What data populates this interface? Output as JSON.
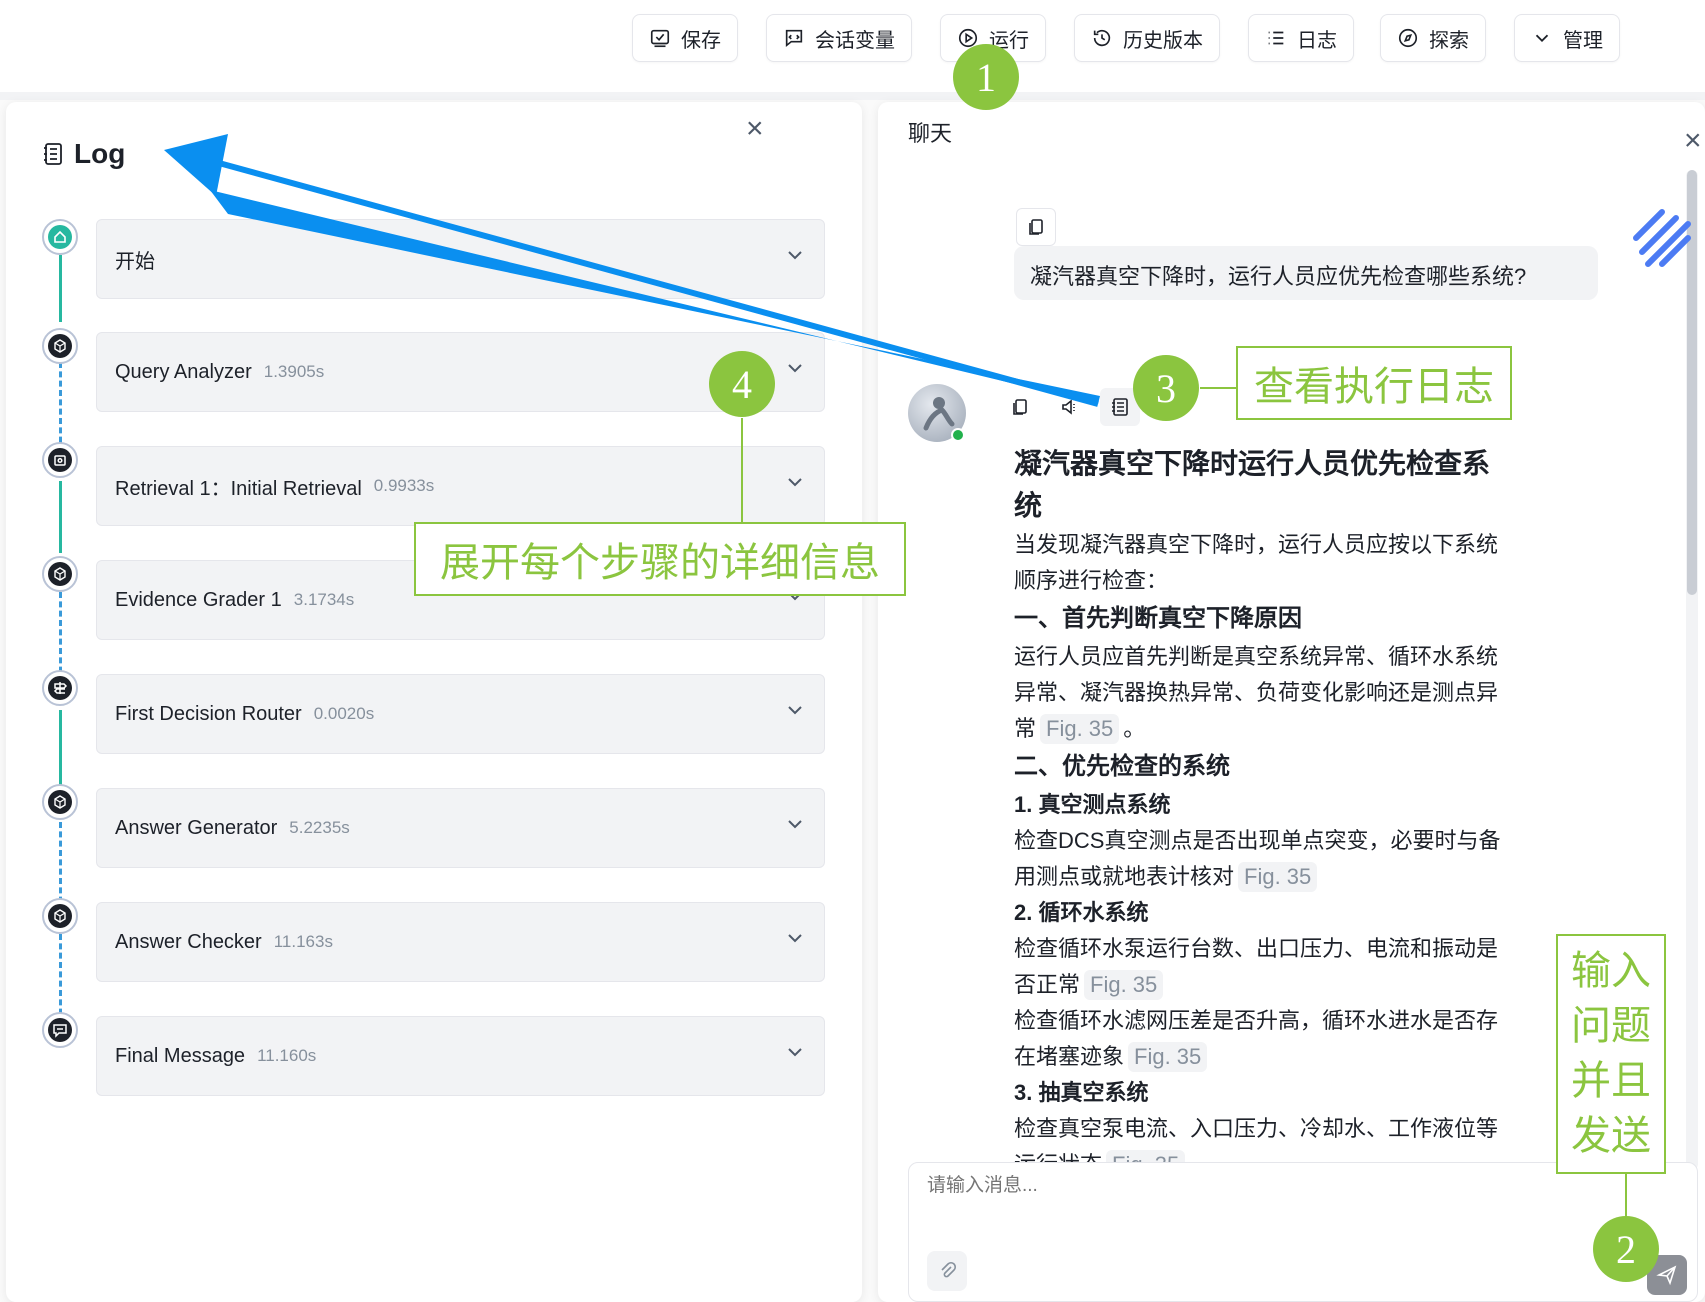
{
  "toolbar": {
    "save": "保存",
    "session_vars": "会话变量",
    "run": "运行",
    "history": "历史版本",
    "log": "日志",
    "explore": "探索",
    "manage": "管理"
  },
  "log_panel": {
    "title": "Log",
    "steps": [
      {
        "name": "开始",
        "time": ""
      },
      {
        "name": "Query Analyzer",
        "time": "1.3905s"
      },
      {
        "name": "Retrieval 1：Initial Retrieval",
        "time": "0.9933s"
      },
      {
        "name": "Evidence Grader 1",
        "time": "3.1734s"
      },
      {
        "name": "First Decision Router",
        "time": "0.0020s"
      },
      {
        "name": "Answer Generator",
        "time": "5.2235s"
      },
      {
        "name": "Answer Checker",
        "time": "11.163s"
      },
      {
        "name": "Final Message",
        "time": "11.160s"
      }
    ]
  },
  "chat_panel": {
    "title": "聊天",
    "user_question": "凝汽器真空下降时，运行人员应优先检查哪些系统?",
    "answer": {
      "title": "凝汽器真空下降时运行人员优先检查系统",
      "intro": "当发现凝汽器真空下降时，运行人员应按以下系统顺序进行检查：",
      "sec1_title": "一、首先判断真空下降原因",
      "sec1_text": "运行人员应首先判断是真空系统异常、循环水系统异常、凝汽器换热异常、负荷变化影响还是测点异常",
      "sec2_title": "二、优先检查的系统",
      "item1_title": "1. 真空测点系统",
      "item1_text": "检查DCS真空测点是否出现单点突变，必要时与备用测点或就地表计核对",
      "item2_title": "2. 循环水系统",
      "item2_text_a": "检查循环水泵运行台数、出口压力、电流和振动是否正常",
      "item2_text_b": "检查循环水滤网压差是否升高，循环水进水是否存在堵塞迹象",
      "item3_title": "3. 抽真空系统",
      "item3_text": "检查真空泵电流、入口压力、冷却水、工作液位等运行状态",
      "fig_ref": "Fig. 35",
      "period": "。"
    },
    "input_placeholder": "请输入消息..."
  },
  "annotations": {
    "badge1": "1",
    "badge2": "2",
    "badge3": "3",
    "badge4": "4",
    "callout3": "查看执行日志",
    "callout4": "展开每个步骤的详细信息",
    "callout2_l1": "输入",
    "callout2_l2": "问题",
    "callout2_l3": "并且",
    "callout2_l4": "发送"
  },
  "colors": {
    "annotation_green": "#8bc53f",
    "arrow_blue": "#0a8ff0",
    "timeline_teal": "#26b8a0",
    "timeline_blue_dashed": "#3a9ad9"
  }
}
